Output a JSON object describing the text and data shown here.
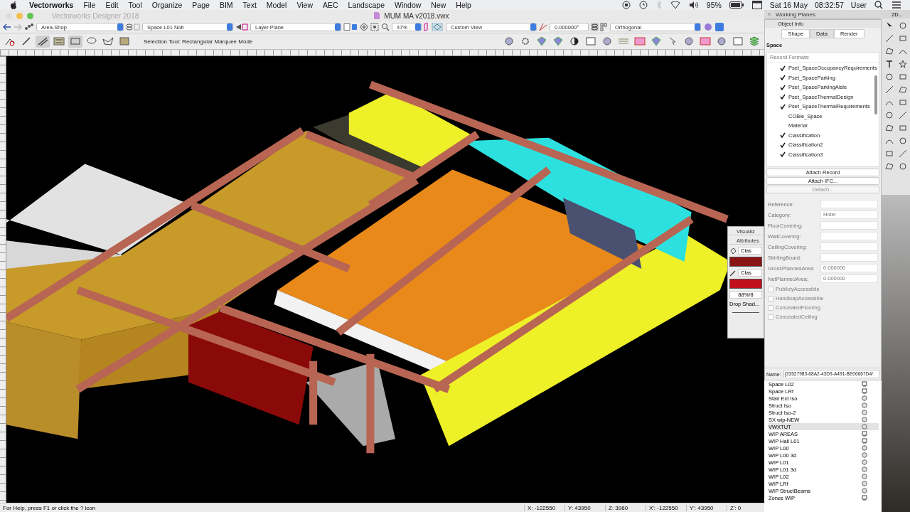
{
  "menubar": {
    "app": "Vectorworks",
    "menus": [
      "File",
      "Edit",
      "Tool",
      "Organize",
      "Page",
      "BIM",
      "Text",
      "Model",
      "View",
      "AEC",
      "Landscape",
      "Window",
      "New",
      "Help"
    ],
    "battery": "95%",
    "date": "Sat 16 May",
    "time": "08:32:57",
    "user": "User"
  },
  "window": {
    "title": "Vectorworks Designer 2018",
    "document": "MUM MA v2018.vwx"
  },
  "view_bar": {
    "class": "Area-Shop",
    "layer": "Space L01 Nob",
    "plane": "Layer Plane",
    "zoom": "47%",
    "view": "Custom View",
    "angle": "0.000000°",
    "projection": "Orthogonal"
  },
  "mode_bar": {
    "modes": [
      {
        "kind": "no-snap",
        "selected": false
      },
      {
        "kind": "single",
        "selected": false
      },
      {
        "kind": "multi",
        "selected": true
      },
      {
        "kind": "settings",
        "selected": false
      },
      {
        "kind": "rect",
        "selected": true
      },
      {
        "kind": "lasso",
        "selected": false
      },
      {
        "kind": "polygon",
        "selected": false
      },
      {
        "kind": "prefs",
        "selected": false
      }
    ],
    "hint": "Selection Tool: Rectangular Marquee Mode"
  },
  "working_planes": {
    "title": "Working Planes"
  },
  "tool_palette": {
    "title": "2D..."
  },
  "object_info": {
    "title": "Object Info",
    "tabs": [
      {
        "label": "Shape",
        "selected": false
      },
      {
        "label": "Data",
        "selected": true
      },
      {
        "label": "Render",
        "selected": false
      }
    ],
    "object_type": "Space",
    "records_label": "Record Formats:",
    "records": [
      {
        "name": "Pset_SpaceOccupancyRequirements",
        "checked": true
      },
      {
        "name": "Pset_SpaceParking",
        "checked": true
      },
      {
        "name": "Pset_SpaceParkingAisle",
        "checked": true
      },
      {
        "name": "Pset_SpaceThermalDesign",
        "checked": true
      },
      {
        "name": "Pset_SpaceThermalRequirements",
        "checked": true
      },
      {
        "name": "COBie_Space",
        "checked": false
      },
      {
        "name": "Material",
        "checked": false
      },
      {
        "name": "Classification",
        "checked": true
      },
      {
        "name": "Classification2",
        "checked": true
      },
      {
        "name": "Classification3",
        "checked": true
      }
    ],
    "buttons": [
      {
        "label": "Attach Record",
        "disabled": false
      },
      {
        "label": "Attach IFC...",
        "disabled": false
      },
      {
        "label": "Detach...",
        "disabled": true
      }
    ],
    "fields": [
      {
        "label": "Reference:",
        "disabled": true
      },
      {
        "label": "Category:",
        "value": "Hotel",
        "disabled": true
      },
      {
        "label": "FloorCovering:",
        "disabled": true
      },
      {
        "label": "WallCovering:",
        "disabled": true
      },
      {
        "label": "CeilingCovering:",
        "disabled": true
      },
      {
        "label": "SkirtingBoard:",
        "disabled": true
      },
      {
        "label": "GrossPlannedArea:",
        "value": "0.000000",
        "disabled": true
      },
      {
        "label": "NetPlannedArea:",
        "value": "0.000000",
        "disabled": true
      }
    ],
    "checkboxes": [
      {
        "label": "PubliclyAccessible",
        "checked": false,
        "disabled": true
      },
      {
        "label": "HandicapAccessible",
        "checked": false,
        "disabled": true
      },
      {
        "label": "ConcealedFlooring",
        "checked": false,
        "disabled": true
      },
      {
        "label": "ConcealedCeiling",
        "checked": false,
        "disabled": true
      }
    ],
    "name_label": "Name:",
    "name_value": "{33527983-68A2-43D9-A491-BE06667D4/"
  },
  "attributes": {
    "tabs": [
      "Visualiz",
      "Attributes"
    ],
    "fill": {
      "label": "Clas",
      "color": "#8a1414"
    },
    "pen": {
      "label": "Clas",
      "color": "#c0101c"
    },
    "opacity": "88%/8",
    "shadow": "Drop Shad..."
  },
  "saved_views": [
    {
      "name": "Space L02",
      "kind": "sheet",
      "selected": false
    },
    {
      "name": "Space LRf",
      "kind": "sheet",
      "selected": false
    },
    {
      "name": "Stair Ext Iso",
      "kind": "view",
      "selected": false
    },
    {
      "name": "Struct Iso",
      "kind": "view",
      "selected": false
    },
    {
      "name": "Struct Iso-2",
      "kind": "view",
      "selected": false
    },
    {
      "name": "SX wip-NEW",
      "kind": "view",
      "selected": false
    },
    {
      "name": "VWXTUT",
      "kind": "view",
      "selected": true
    },
    {
      "name": "WIP AREAS",
      "kind": "sheet",
      "selected": false
    },
    {
      "name": "WIP Hall L01",
      "kind": "sheet",
      "selected": false
    },
    {
      "name": "WIP L00",
      "kind": "view",
      "selected": false
    },
    {
      "name": "WIP L00 3d",
      "kind": "view",
      "selected": false
    },
    {
      "name": "WIP L01",
      "kind": "view",
      "selected": false
    },
    {
      "name": "WIP L01 3d",
      "kind": "view",
      "selected": false
    },
    {
      "name": "WIP L02",
      "kind": "view",
      "selected": false
    },
    {
      "name": "WIP LRf",
      "kind": "view",
      "selected": false
    },
    {
      "name": "WIP StructBeams",
      "kind": "view",
      "selected": false
    },
    {
      "name": "Zones WIP",
      "kind": "sheet",
      "selected": false
    }
  ],
  "status_bar": {
    "help": "For Help, press F1 or click the ? icon",
    "coords": [
      {
        "label": "X:",
        "value": "-122550"
      },
      {
        "label": "Y:",
        "value": "43950"
      },
      {
        "label": "Z:",
        "value": "3960"
      },
      {
        "label": "X':",
        "value": "-122550"
      },
      {
        "label": "Y':",
        "value": "43950"
      },
      {
        "label": "Z':",
        "value": "0"
      }
    ]
  }
}
